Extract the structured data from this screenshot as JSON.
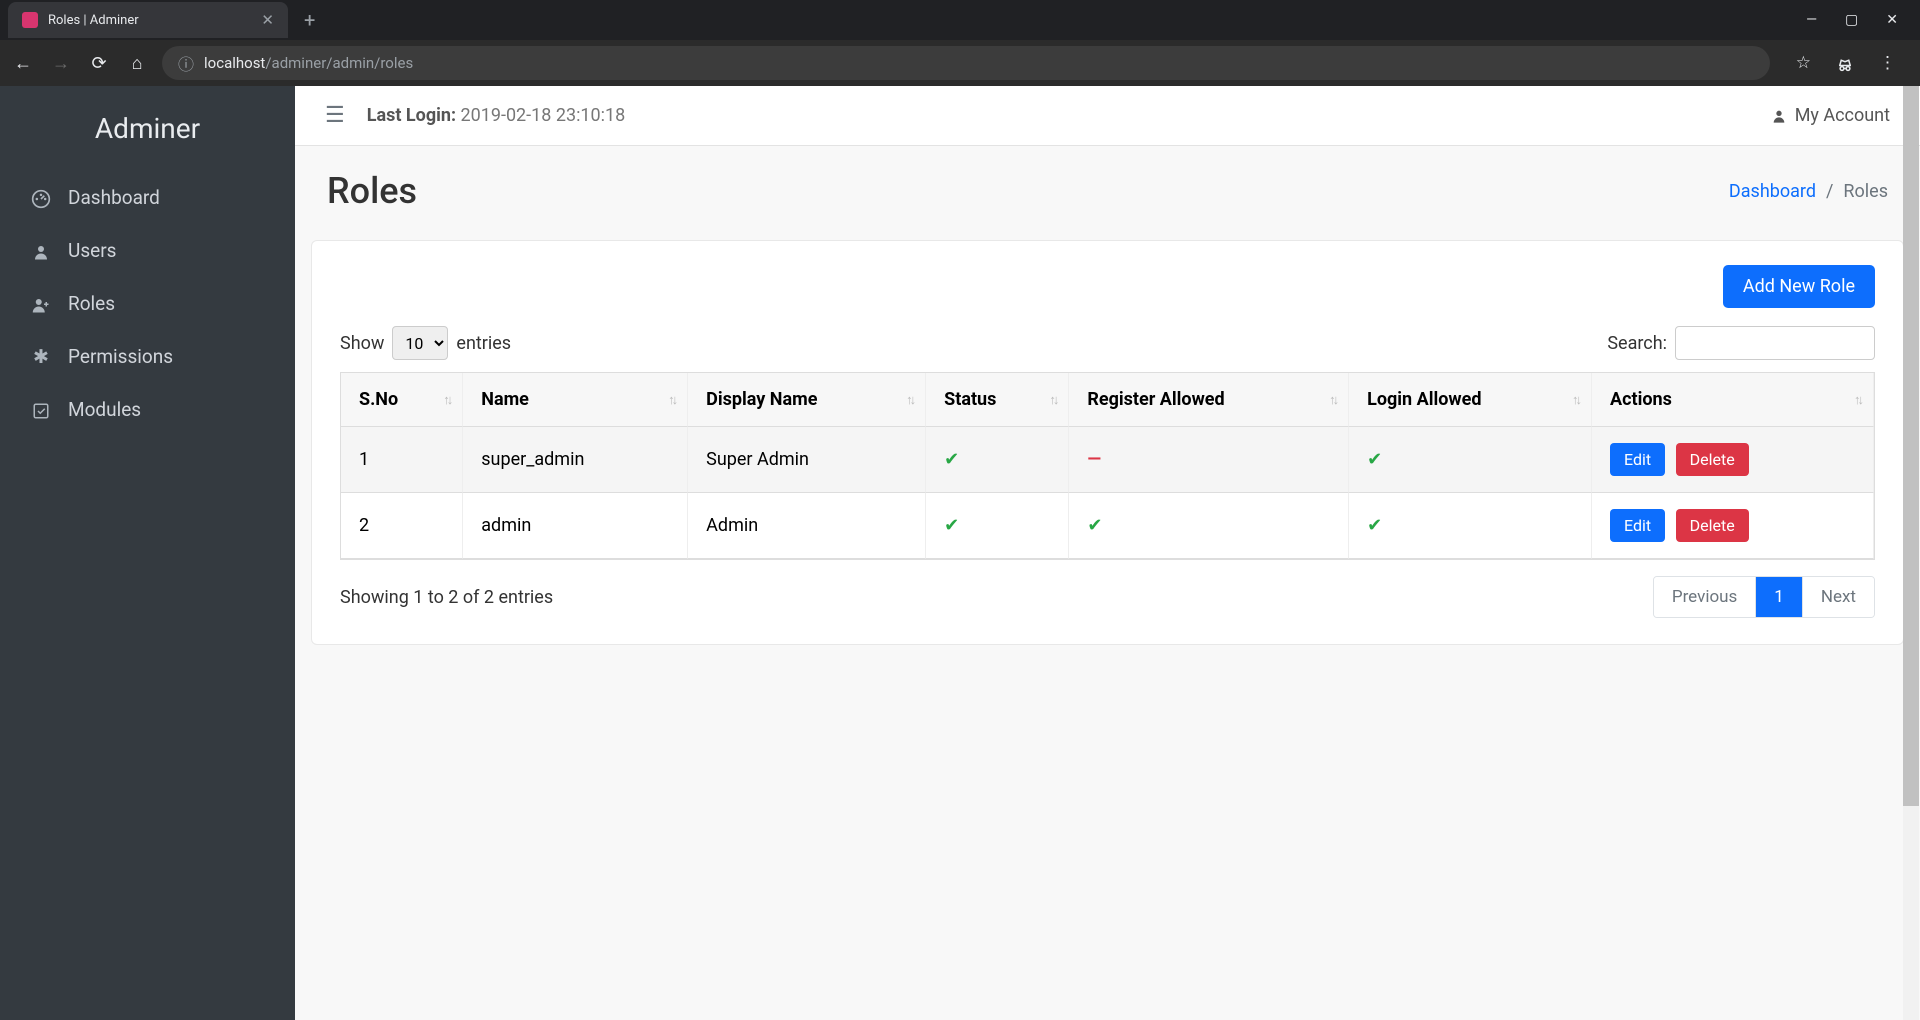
{
  "browser": {
    "tab_title": "Roles | Adminer",
    "url_domain": "localhost",
    "url_path": "/adminer/admin/roles"
  },
  "sidebar": {
    "brand": "Adminer",
    "items": [
      {
        "label": "Dashboard",
        "icon": "dashboard-icon"
      },
      {
        "label": "Users",
        "icon": "user-icon"
      },
      {
        "label": "Roles",
        "icon": "user-plus-icon"
      },
      {
        "label": "Permissions",
        "icon": "asterisk-icon"
      },
      {
        "label": "Modules",
        "icon": "check-square-icon"
      }
    ]
  },
  "topbar": {
    "last_login_label": "Last Login:",
    "last_login_value": "2019-02-18 23:10:18",
    "my_account": "My Account"
  },
  "page": {
    "title": "Roles",
    "breadcrumb_dashboard": "Dashboard",
    "breadcrumb_current": "Roles"
  },
  "card": {
    "add_button": "Add New Role",
    "show_label": "Show",
    "entries_label": "entries",
    "length_value": "10",
    "search_label": "Search:",
    "search_value": "",
    "columns": [
      "S.No",
      "Name",
      "Display Name",
      "Status",
      "Register Allowed",
      "Login Allowed",
      "Actions"
    ],
    "rows": [
      {
        "sno": "1",
        "name": "super_admin",
        "display": "Super Admin",
        "status": "check",
        "register": "minus",
        "login": "check"
      },
      {
        "sno": "2",
        "name": "admin",
        "display": "Admin",
        "status": "check",
        "register": "check",
        "login": "check"
      }
    ],
    "edit_label": "Edit",
    "delete_label": "Delete",
    "info_text": "Showing 1 to 2 of 2 entries",
    "prev_label": "Previous",
    "page_num": "1",
    "next_label": "Next"
  }
}
